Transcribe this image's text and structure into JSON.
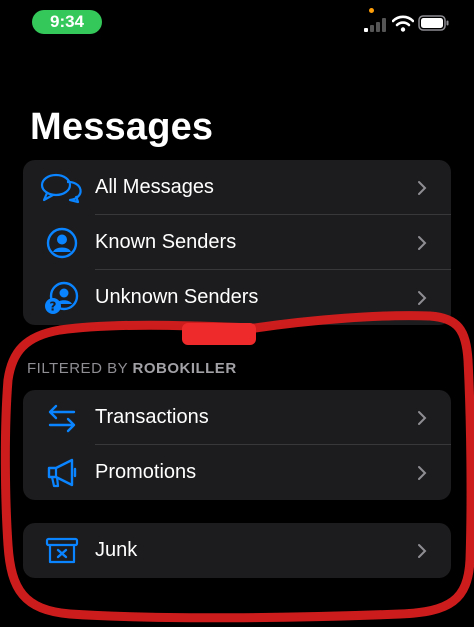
{
  "status": {
    "time": "9:34"
  },
  "page": {
    "title": "Messages"
  },
  "main_list": [
    {
      "label": "All Messages",
      "icon": "chat-bubbles-icon"
    },
    {
      "label": "Known Senders",
      "icon": "person-circle-icon"
    },
    {
      "label": "Unknown Senders",
      "icon": "unknown-person-icon"
    }
  ],
  "filtered_header": {
    "prefix": "FILTERED BY",
    "brand": "ROBOKILLER"
  },
  "filtered_list": [
    {
      "label": "Transactions",
      "icon": "arrows-exchange-icon"
    },
    {
      "label": "Promotions",
      "icon": "megaphone-icon"
    }
  ],
  "junk_list": [
    {
      "label": "Junk",
      "icon": "trash-bin-icon"
    }
  ],
  "colors": {
    "accent": "#0a84ff",
    "card": "#1c1c1e",
    "annotation": "#e01e1e",
    "status_pill": "#34c759"
  }
}
